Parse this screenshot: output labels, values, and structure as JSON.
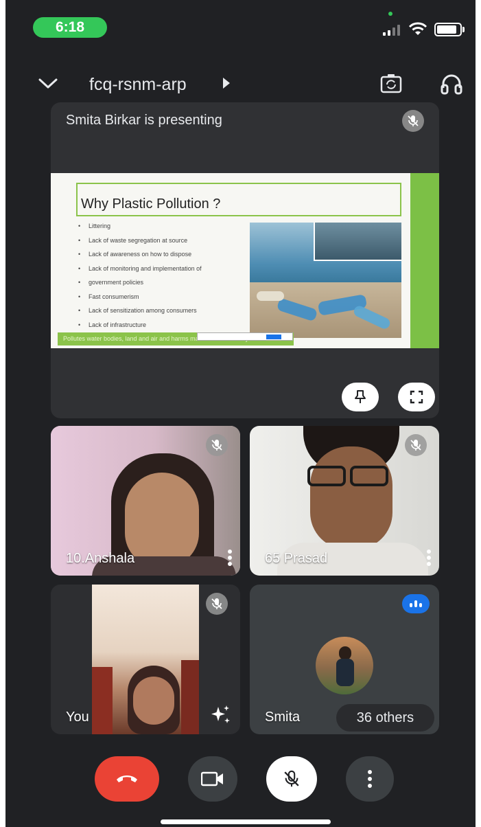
{
  "status_bar": {
    "time": "6:18"
  },
  "header": {
    "meeting_code": "fcq-rsnm-arp"
  },
  "presentation": {
    "label": "Smita Birkar is presenting",
    "slide": {
      "title": "Why Plastic Pollution ?",
      "bullets": [
        "Littering",
        "Lack of waste segregation at source",
        "Lack of awareness on how to dispose",
        "Lack of monitoring and implementation of",
        "government policies",
        "Fast consumerism",
        "Lack of sensitization among consumers",
        "Lack of infrastructure"
      ],
      "footer": "Pollutes water bodies, land and air and harms marine life and ecosystem"
    }
  },
  "participants": [
    {
      "name": "10.Anshala",
      "muted": true
    },
    {
      "name": "65 Prasad",
      "muted": true
    },
    {
      "name": "You",
      "muted": true
    },
    {
      "name": "Smita",
      "speaking": true
    }
  ],
  "others_count_label": "36 others",
  "colors": {
    "background": "#202124",
    "tile": "#3c4043",
    "end_call": "#ea4335",
    "speaking": "#1a73e8",
    "status_pill": "#34c759",
    "slide_accent": "#8bc34a"
  },
  "icons": {
    "chevron": "chevron-down-icon",
    "arrow": "play-right-icon",
    "camera_switch": "camera-switch-icon",
    "audio": "headphones-icon",
    "mic_off": "mic-off-icon",
    "pin": "pin-icon",
    "fullscreen": "fullscreen-icon",
    "more": "more-vert-icon",
    "effects": "sparkle-icon",
    "end_call": "phone-hangup-icon",
    "video": "videocam-icon"
  }
}
